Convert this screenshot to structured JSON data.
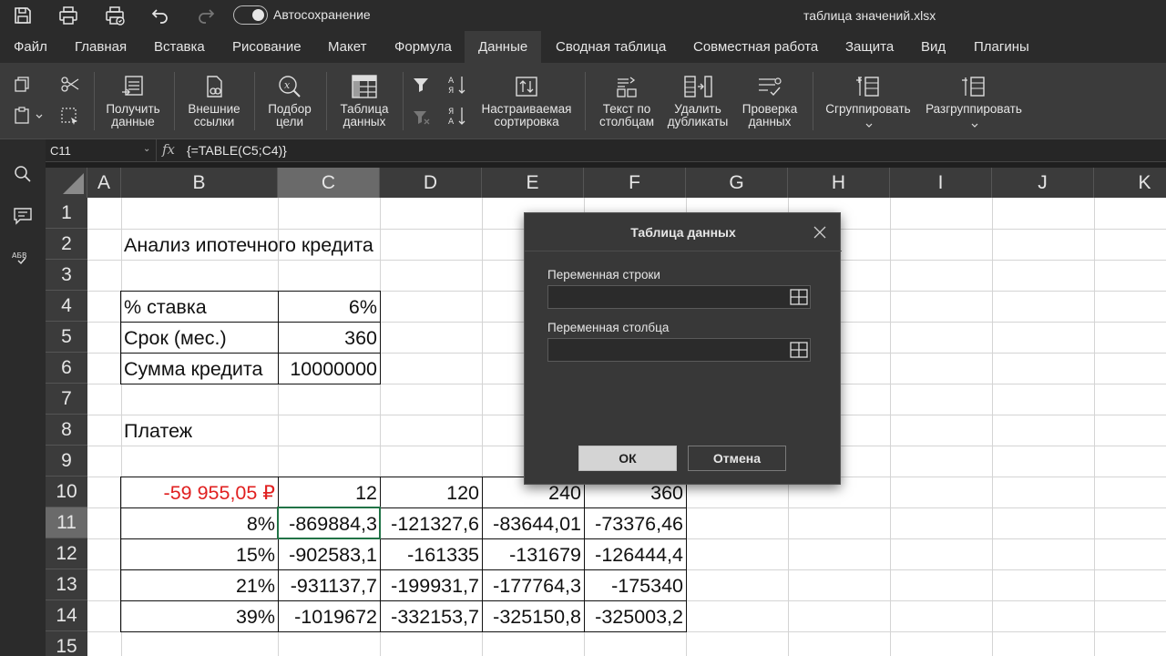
{
  "window": {
    "autosave_label": "Автосохранение",
    "document_title": "таблица значений.xlsx"
  },
  "menu": {
    "tabs": [
      "Файл",
      "Главная",
      "Вставка",
      "Рисование",
      "Макет",
      "Формула",
      "Данные",
      "Сводная таблица",
      "Совместная работа",
      "Защита",
      "Вид",
      "Плагины"
    ],
    "active": "Данные"
  },
  "ribbon": {
    "get_data": "Получить данные",
    "external_links": "Внешние ссылки",
    "goal_seek": "Подбор цели",
    "data_table": "Таблица данных",
    "custom_sort": "Настраиваемая сортировка",
    "text_to_columns": "Текст по столбцам",
    "remove_duplicates": "Удалить дубликаты",
    "data_validation": "Проверка данных",
    "group": "Сгруппировать",
    "ungroup": "Разгруппировать"
  },
  "formula_bar": {
    "cell_ref": "C11",
    "fx": "fx",
    "formula": "{=TABLE(C5;C4)}"
  },
  "sheet": {
    "columns": [
      "A",
      "B",
      "C",
      "D",
      "E",
      "F",
      "G",
      "H",
      "I",
      "J",
      "K"
    ],
    "selected_column": "C",
    "rows": [
      "1",
      "2",
      "3",
      "4",
      "5",
      "6",
      "7",
      "8",
      "9",
      "10",
      "11",
      "12",
      "13",
      "14",
      "15"
    ],
    "selected_row": "11",
    "cells": {
      "B2": "Анализ ипотечного кредита",
      "B4": "% ставка",
      "C4": "6%",
      "B5": "Срок (мес.)",
      "C5": "360",
      "B6": "Сумма кредита",
      "C6": "10000000",
      "B8": "Платеж",
      "B10": "-59 955,05 ₽",
      "C10": "12",
      "D10": "120",
      "E10": "240",
      "F10": "360",
      "B11": "8%",
      "C11": "-869884,3",
      "D11": "-121327,6",
      "E11": "-83644,01",
      "F11": "-73376,46",
      "B12": "15%",
      "C12": "-902583,1",
      "D12": "-161335",
      "E12": "-131679",
      "F12": "-126444,4",
      "B13": "21%",
      "C13": "-931137,7",
      "D13": "-199931,7",
      "E13": "-177764,3",
      "F13": "-175340",
      "B14": "39%",
      "C14": "-1019672",
      "D14": "-332153,7",
      "E14": "-325150,8",
      "F14": "-325003,2"
    },
    "payment_color": "#e02020"
  },
  "dialog": {
    "title": "Таблица данных",
    "row_input_label": "Переменная строки",
    "row_input_value": "",
    "column_input_label": "Переменная столбца",
    "column_input_value": "",
    "ok": "ОК",
    "cancel": "Отмена"
  }
}
